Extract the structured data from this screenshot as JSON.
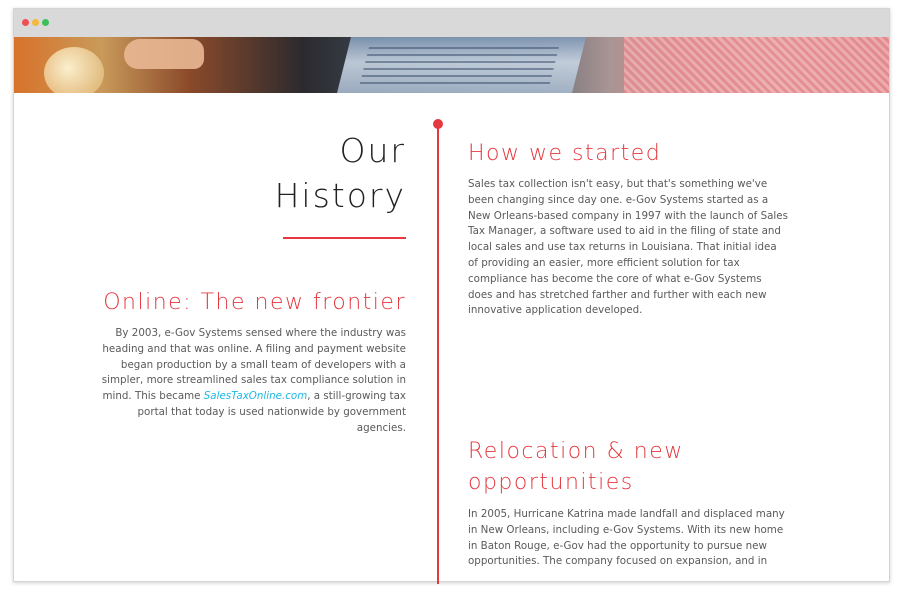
{
  "colors": {
    "accent": "#e5383f",
    "link": "#1fb8e3",
    "text": "#5a5a5a",
    "heading": "#222222"
  },
  "window": {
    "controls": [
      "close-dot",
      "minimize-dot",
      "maximize-dot"
    ]
  },
  "history": {
    "title_line1": "Our",
    "title_line2": "History"
  },
  "sections": {
    "online": {
      "title": "Online: The new frontier",
      "body_before_link": "By 2003, e-Gov Systems sensed where the industry was heading and that was online. A filing and payment website began production by a small team of developers with a simpler, more streamlined sales tax compliance solution in mind. This became ",
      "link_text": "SalesTaxOnline.com",
      "body_after_link": ", a still-growing tax portal that today is used nationwide by government agencies."
    },
    "started": {
      "title": "How we started",
      "body": "Sales tax collection isn't easy, but that's something we've been changing since day one. e-Gov Systems started as a New Orleans-based company in 1997 with the launch of Sales Tax Manager, a software used to aid in the filing of state and local sales and use tax returns in Louisiana. That initial idea of providing an easier, more efficient solution for tax compliance has become the core of what e-Gov Systems does and has stretched farther and further with each new innovative application developed."
    },
    "relocation": {
      "title": "Relocation & new opportunities",
      "body": "In 2005, Hurricane Katrina made landfall and displaced many in New Orleans, including e-Gov Systems. With its new home in Baton Rouge, e-Gov had the opportunity to pursue new opportunities. The company focused on expansion, and in"
    }
  }
}
